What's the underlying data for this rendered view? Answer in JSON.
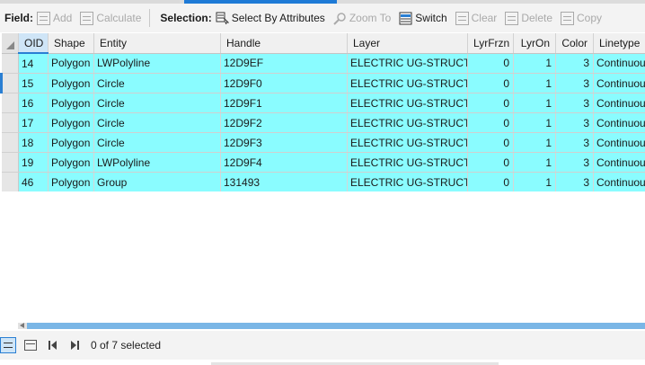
{
  "toolbar": {
    "field_label": "Field:",
    "add": "Add",
    "calculate": "Calculate",
    "selection_label": "Selection:",
    "select_by_attributes": "Select By Attributes",
    "zoom_to": "Zoom To",
    "switch": "Switch",
    "clear": "Clear",
    "delete": "Delete",
    "copy": "Copy"
  },
  "table": {
    "columns": [
      "OID",
      "Shape",
      "Entity",
      "Handle",
      "Layer",
      "LyrFrzn",
      "LyrOn",
      "Color",
      "Linetype"
    ],
    "rows": [
      [
        "14",
        "Polygon",
        "LWPolyline",
        "12D9EF",
        "ELECTRIC UG-STRUCT...",
        "0",
        "1",
        "3",
        "Continuous"
      ],
      [
        "15",
        "Polygon",
        "Circle",
        "12D9F0",
        "ELECTRIC UG-STRUCT...",
        "0",
        "1",
        "3",
        "Continuous"
      ],
      [
        "16",
        "Polygon",
        "Circle",
        "12D9F1",
        "ELECTRIC UG-STRUCT...",
        "0",
        "1",
        "3",
        "Continuous"
      ],
      [
        "17",
        "Polygon",
        "Circle",
        "12D9F2",
        "ELECTRIC UG-STRUCT...",
        "0",
        "1",
        "3",
        "Continuous"
      ],
      [
        "18",
        "Polygon",
        "Circle",
        "12D9F3",
        "ELECTRIC UG-STRUCT...",
        "0",
        "1",
        "3",
        "Continuous"
      ],
      [
        "19",
        "Polygon",
        "LWPolyline",
        "12D9F4",
        "ELECTRIC UG-STRUCT...",
        "0",
        "1",
        "3",
        "Continuous"
      ],
      [
        "46",
        "Polygon",
        "Group",
        "131493",
        "ELECTRIC UG-STRUCT...",
        "0",
        "1",
        "3",
        "Continuous"
      ]
    ]
  },
  "footer": {
    "status": "0 of 7 selected"
  },
  "colors": {
    "row_highlight": "#8afcff",
    "accent": "#2a7fd3"
  }
}
